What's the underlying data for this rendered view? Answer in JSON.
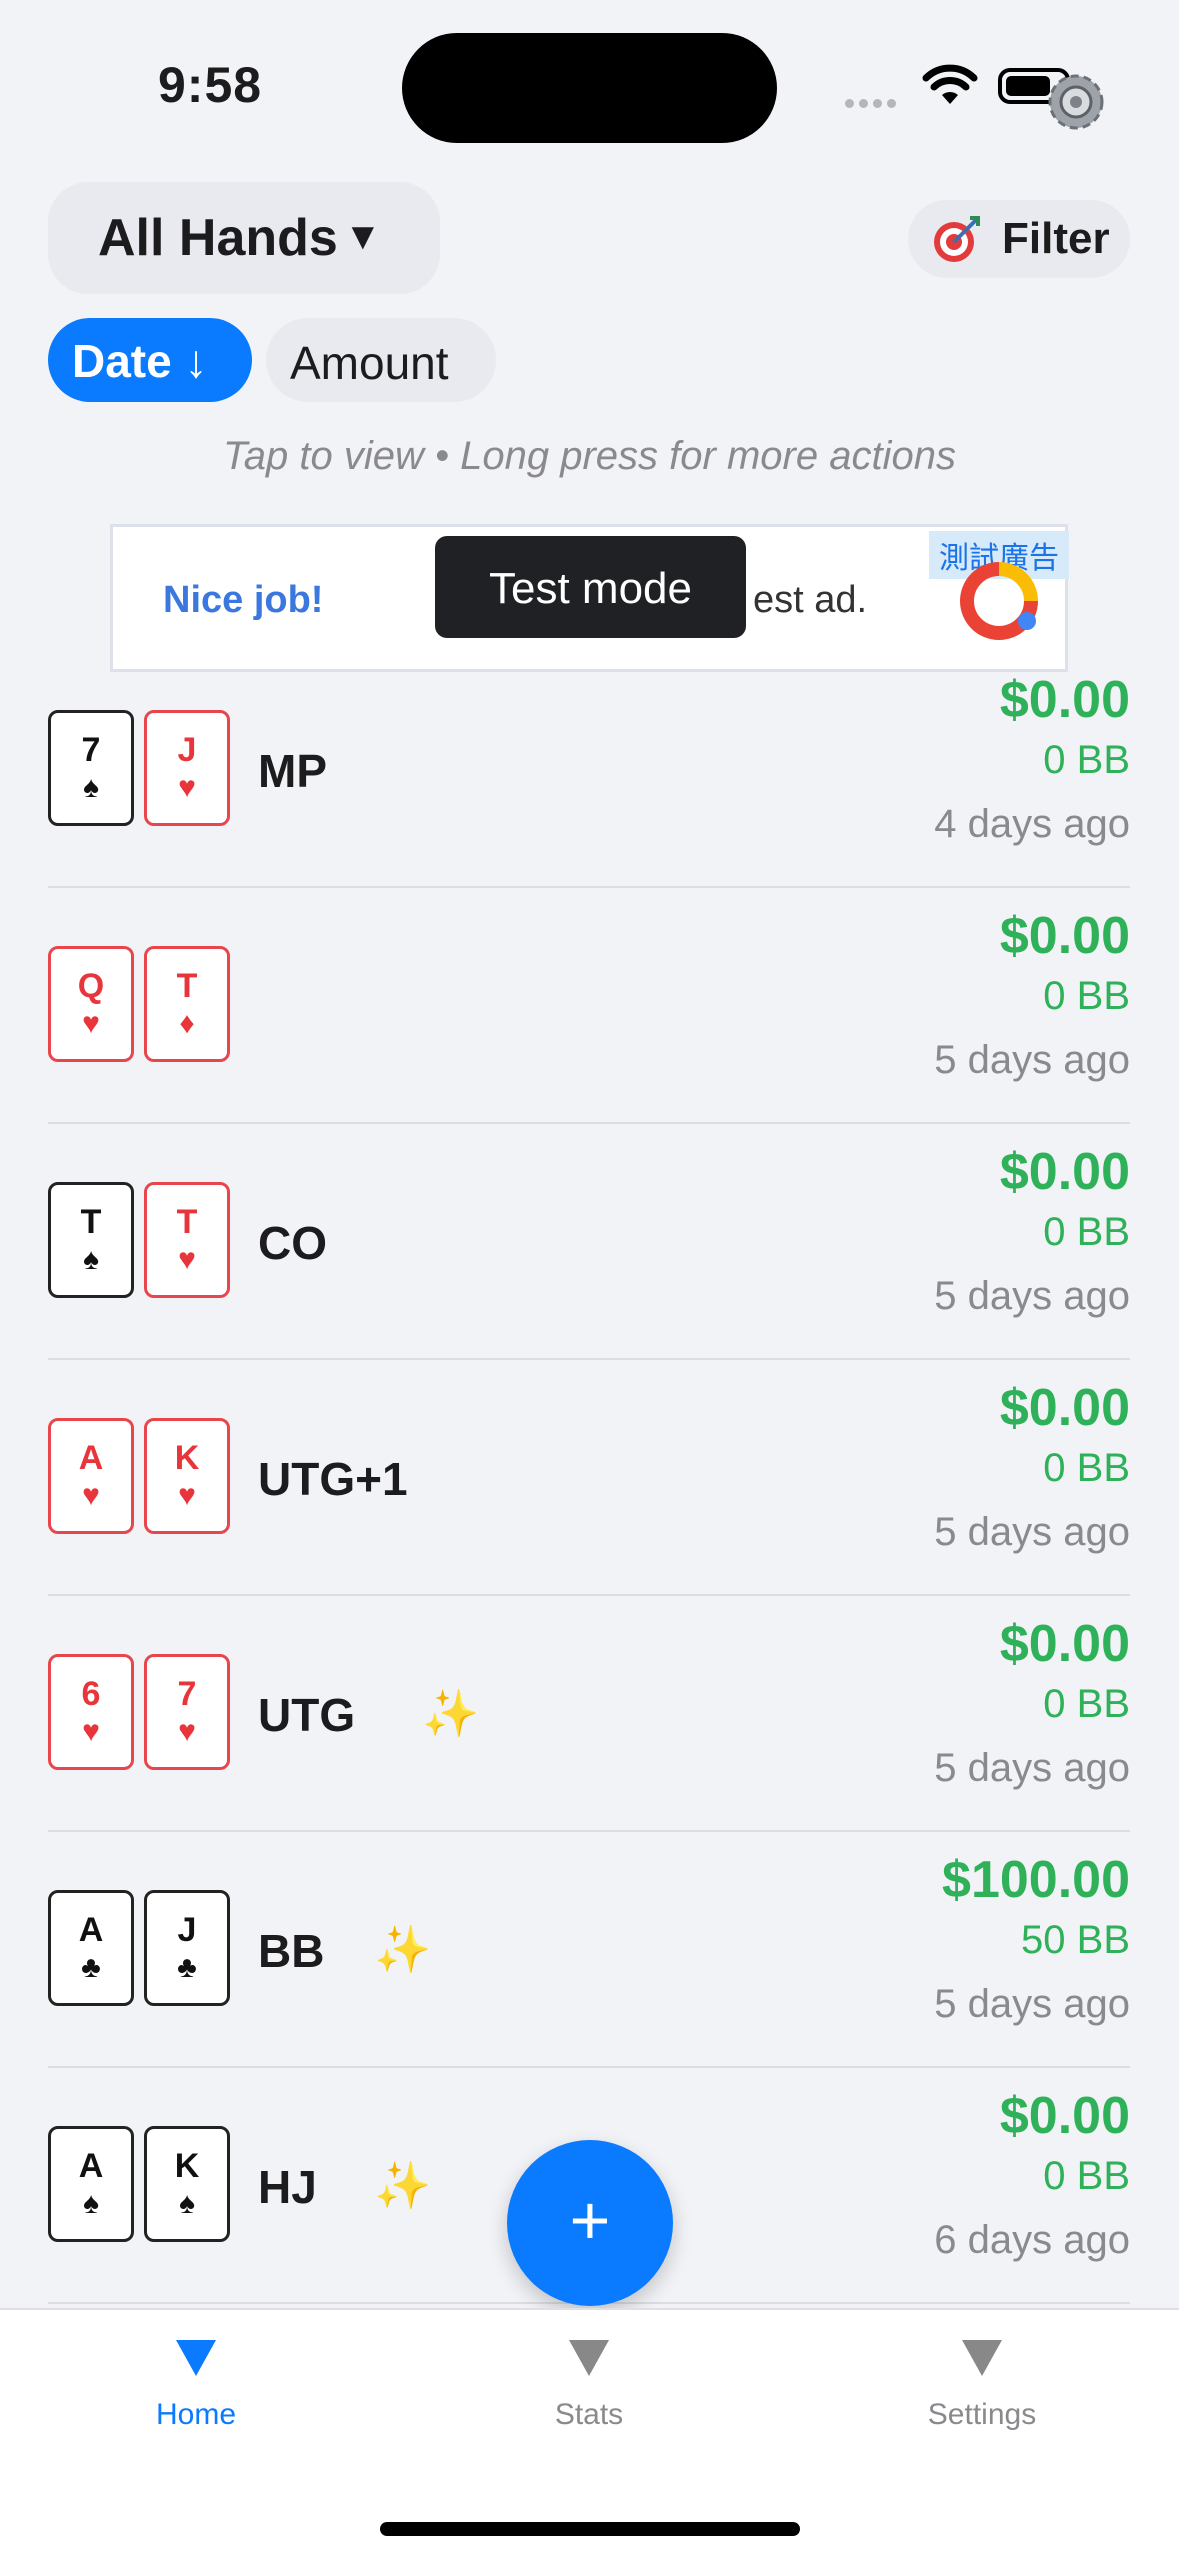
{
  "status": {
    "time": "9:58"
  },
  "header": {
    "filter_title": "All Hands",
    "filter_caret": "▼",
    "filter_button": "Filter"
  },
  "sort": {
    "date_label": "Date ↓",
    "amount_label": "Amount"
  },
  "hint": "Tap to view • Long press for more actions",
  "ad": {
    "headline": "Nice job!",
    "body": "est ad.",
    "badge": "測試廣告",
    "toast": "Test mode"
  },
  "hands": [
    {
      "cards": [
        {
          "rank": "7",
          "suit": "♠",
          "color": "black"
        },
        {
          "rank": "J",
          "suit": "♥",
          "color": "red"
        }
      ],
      "position": "MP",
      "sparkle": false,
      "amount": "$0.00",
      "bb": "0 BB",
      "ago": "4 days ago"
    },
    {
      "cards": [
        {
          "rank": "Q",
          "suit": "♥",
          "color": "red"
        },
        {
          "rank": "T",
          "suit": "♦",
          "color": "red"
        }
      ],
      "position": "",
      "sparkle": false,
      "amount": "$0.00",
      "bb": "0 BB",
      "ago": "5 days ago"
    },
    {
      "cards": [
        {
          "rank": "T",
          "suit": "♠",
          "color": "black"
        },
        {
          "rank": "T",
          "suit": "♥",
          "color": "red"
        }
      ],
      "position": "CO",
      "sparkle": false,
      "amount": "$0.00",
      "bb": "0 BB",
      "ago": "5 days ago"
    },
    {
      "cards": [
        {
          "rank": "A",
          "suit": "♥",
          "color": "red"
        },
        {
          "rank": "K",
          "suit": "♥",
          "color": "red"
        }
      ],
      "position": "UTG+1",
      "sparkle": false,
      "amount": "$0.00",
      "bb": "0 BB",
      "ago": "5 days ago"
    },
    {
      "cards": [
        {
          "rank": "6",
          "suit": "♥",
          "color": "red"
        },
        {
          "rank": "7",
          "suit": "♥",
          "color": "red"
        }
      ],
      "position": "UTG",
      "sparkle": true,
      "amount": "$0.00",
      "bb": "0 BB",
      "ago": "5 days ago"
    },
    {
      "cards": [
        {
          "rank": "A",
          "suit": "♣",
          "color": "black"
        },
        {
          "rank": "J",
          "suit": "♣",
          "color": "black"
        }
      ],
      "position": "BB",
      "sparkle": true,
      "amount": "$100.00",
      "bb": "50 BB",
      "ago": "5 days ago"
    },
    {
      "cards": [
        {
          "rank": "A",
          "suit": "♠",
          "color": "black"
        },
        {
          "rank": "K",
          "suit": "♠",
          "color": "black"
        }
      ],
      "position": "HJ",
      "sparkle": true,
      "amount": "$0.00",
      "bb": "0 BB",
      "ago": "6 days ago"
    }
  ],
  "sparkle_glyph": "✨",
  "fab": {
    "label": "+"
  },
  "tabs": [
    {
      "label": "Home",
      "active": true
    },
    {
      "label": "Stats",
      "active": false
    },
    {
      "label": "Settings",
      "active": false
    }
  ],
  "colors": {
    "accent": "#0a7aff",
    "profit": "#2fb15a",
    "red_suit": "#e8353c"
  }
}
